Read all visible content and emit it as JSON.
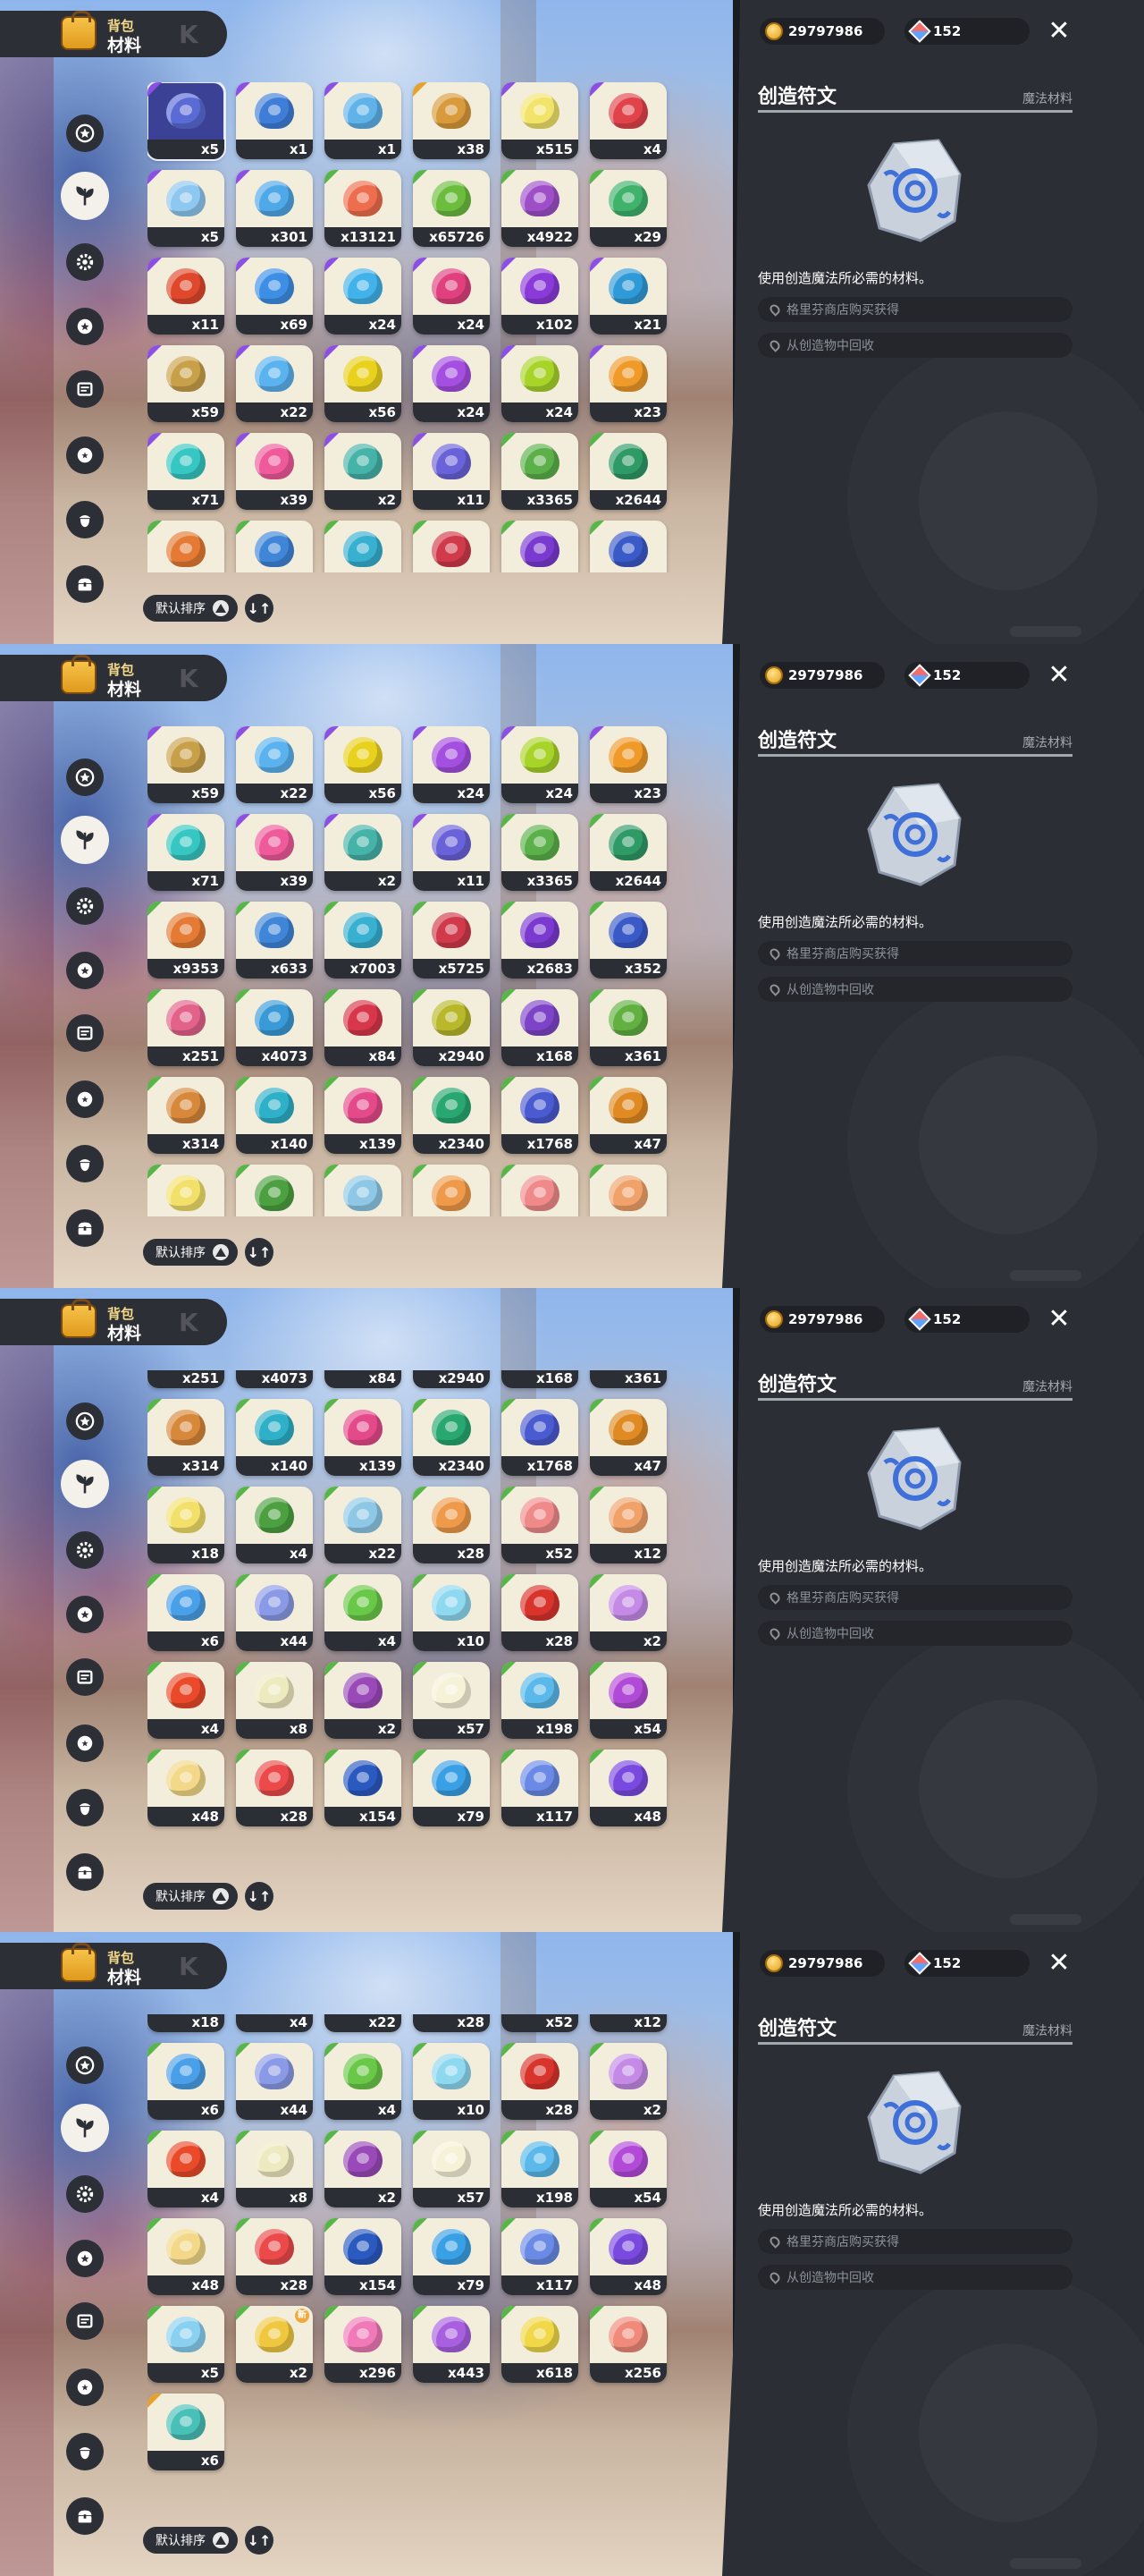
{
  "header": {
    "title_small": "背包",
    "title_big": "材料",
    "title_mark": "K"
  },
  "currency": {
    "gold": "29797986",
    "gems": "152"
  },
  "tabs": [
    "star-badge-icon",
    "leaf-icon",
    "gear-icon",
    "star-ring-icon",
    "potion-icon",
    "dragon-ball-icon",
    "acorn-icon",
    "chest-icon"
  ],
  "active_tab": 1,
  "sort": {
    "label": "默认排序",
    "order_icon": "↓↑"
  },
  "detail": {
    "name": "创造符文",
    "type": "魔法材料",
    "description": "使用创造魔法所必需的材料。",
    "sources": [
      "格里芬商店购买获得",
      "从创造物中回收"
    ]
  },
  "items": [
    {
      "id": "rune",
      "count": "x5",
      "color": "#5a6bd6",
      "rarity": "#8c4fe4"
    },
    {
      "id": "blue-pot",
      "count": "x1",
      "color": "#3f7ed8",
      "rarity": "#8c4fe4"
    },
    {
      "id": "necklace",
      "count": "x1",
      "color": "#5fb3e8",
      "rarity": "#8c4fe4"
    },
    {
      "id": "gold-orb",
      "count": "x38",
      "color": "#d89a3a",
      "rarity": "#e6a230"
    },
    {
      "id": "crystal",
      "count": "x515",
      "color": "#f2e36a",
      "rarity": "#8c4fe4"
    },
    {
      "id": "hat",
      "count": "x4",
      "color": "#e0444a",
      "rarity": "#8c4fe4"
    },
    {
      "id": "cloud",
      "count": "x5",
      "color": "#8ec7ef",
      "rarity": "#8c4fe4"
    },
    {
      "id": "ice",
      "count": "x301",
      "color": "#4fa8e8",
      "rarity": "#8c4fe4"
    },
    {
      "id": "peach",
      "count": "x13121",
      "color": "#ee6d4e",
      "rarity": "#58b548"
    },
    {
      "id": "green-fruit",
      "count": "x65726",
      "color": "#6cbd3e",
      "rarity": "#58b548"
    },
    {
      "id": "purple-fruit",
      "count": "x4922",
      "color": "#9e4fc8",
      "rarity": "#58b548"
    },
    {
      "id": "green-gem",
      "count": "x29",
      "color": "#3fb36c",
      "rarity": "#58b548"
    },
    {
      "id": "red-gem",
      "count": "x11",
      "color": "#e0482c",
      "rarity": "#8c4fe4"
    },
    {
      "id": "blue-gem",
      "count": "x69",
      "color": "#3d8fe6",
      "rarity": "#8c4fe4"
    },
    {
      "id": "sky-gem",
      "count": "x24",
      "color": "#42b2ea",
      "rarity": "#8c4fe4"
    },
    {
      "id": "pink-gem",
      "count": "x24",
      "color": "#e0407e",
      "rarity": "#8c4fe4"
    },
    {
      "id": "violet-gem",
      "count": "x102",
      "color": "#8a3ad8",
      "rarity": "#8c4fe4"
    },
    {
      "id": "azure-gem",
      "count": "x21",
      "color": "#2f9ad8",
      "rarity": "#8c4fe4"
    },
    {
      "id": "amber-gem",
      "count": "x59",
      "color": "#c9a04a",
      "rarity": "#8c4fe4"
    },
    {
      "id": "light-blue-gem",
      "count": "x22",
      "color": "#5ab2ee",
      "rarity": "#8c4fe4"
    },
    {
      "id": "yellow-gem",
      "count": "x56",
      "color": "#e9d21e",
      "rarity": "#8c4fe4"
    },
    {
      "id": "purple-gem",
      "count": "x24",
      "color": "#a44fe0",
      "rarity": "#8c4fe4"
    },
    {
      "id": "lime-gem",
      "count": "x24",
      "color": "#a8d42a",
      "rarity": "#8c4fe4"
    },
    {
      "id": "orange-gem",
      "count": "x23",
      "color": "#f09a2a",
      "rarity": "#8c4fe4"
    },
    {
      "id": "teal-gem",
      "count": "x71",
      "color": "#36c7c2",
      "rarity": "#8c4fe4"
    },
    {
      "id": "rose-gem",
      "count": "x39",
      "color": "#ee5a9a",
      "rarity": "#8c4fe4"
    },
    {
      "id": "mint-gem",
      "count": "x2",
      "color": "#45b3a8",
      "rarity": "#8c4fe4"
    },
    {
      "id": "swirl-gem",
      "count": "x11",
      "color": "#6a62d8",
      "rarity": "#8c4fe4"
    },
    {
      "id": "green-potion",
      "count": "x3365",
      "color": "#5cb04a",
      "rarity": "#58b548"
    },
    {
      "id": "jade-potion",
      "count": "x2644",
      "color": "#2e9a66",
      "rarity": "#58b548"
    },
    {
      "id": "orange-flask",
      "count": "x9353",
      "color": "#e47a34",
      "rarity": "#58b548"
    },
    {
      "id": "blue-flask",
      "count": "x633",
      "color": "#3f86d8",
      "rarity": "#58b548"
    },
    {
      "id": "cyan-flask",
      "count": "x7003",
      "color": "#38b0d0",
      "rarity": "#58b548"
    },
    {
      "id": "red-flask",
      "count": "x5725",
      "color": "#d03a4a",
      "rarity": "#58b548"
    },
    {
      "id": "violet-flask",
      "count": "x2683",
      "color": "#7a3ad0",
      "rarity": "#58b548"
    },
    {
      "id": "navy-flask",
      "count": "x352",
      "color": "#3a5ac8",
      "rarity": "#58b548"
    },
    {
      "id": "pink-flask",
      "count": "x251",
      "color": "#e2628a",
      "rarity": "#58b548"
    },
    {
      "id": "sea-flask",
      "count": "x4073",
      "color": "#3a9ad8",
      "rarity": "#58b548"
    },
    {
      "id": "ruby-flask",
      "count": "x84",
      "color": "#d8364a",
      "rarity": "#58b548"
    },
    {
      "id": "olive-flask",
      "count": "x2940",
      "color": "#b8b82a",
      "rarity": "#58b548"
    },
    {
      "id": "plum-flask",
      "count": "x168",
      "color": "#7e44c8",
      "rarity": "#58b548"
    },
    {
      "id": "grass-flask",
      "count": "x361",
      "color": "#62b040",
      "rarity": "#58b548"
    },
    {
      "id": "amber-flask",
      "count": "x314",
      "color": "#d8883a",
      "rarity": "#58b548"
    },
    {
      "id": "aqua-flask",
      "count": "x140",
      "color": "#2eb0c8",
      "rarity": "#58b548"
    },
    {
      "id": "magenta-flask",
      "count": "x139",
      "color": "#e44a8a",
      "rarity": "#58b548"
    },
    {
      "id": "emerald-flask",
      "count": "x2340",
      "color": "#28a870",
      "rarity": "#58b548"
    },
    {
      "id": "indigo-flask",
      "count": "x1768",
      "color": "#4a5ad0",
      "rarity": "#58b548"
    },
    {
      "id": "pumpkin",
      "count": "x47",
      "color": "#e08a24",
      "rarity": "#58b548"
    },
    {
      "id": "yellow-flower",
      "count": "x18",
      "color": "#f2e06a",
      "rarity": "#58b548"
    },
    {
      "id": "green-bud",
      "count": "x4",
      "color": "#4ca040",
      "rarity": "#58b548"
    },
    {
      "id": "blue-bell",
      "count": "x22",
      "color": "#8ec8e6",
      "rarity": "#58b548"
    },
    {
      "id": "orange-mushroom",
      "count": "x28",
      "color": "#ee9a4a",
      "rarity": "#58b548"
    },
    {
      "id": "pink-flower",
      "count": "x52",
      "color": "#f08a8a",
      "rarity": "#58b548"
    },
    {
      "id": "peach-flower",
      "count": "x12",
      "color": "#f0a26a",
      "rarity": "#58b548"
    },
    {
      "id": "blue-flower",
      "count": "x6",
      "color": "#4aa0e8",
      "rarity": "#58b548"
    },
    {
      "id": "iris",
      "count": "x44",
      "color": "#8a9ae6",
      "rarity": "#58b548"
    },
    {
      "id": "star-leaf",
      "count": "x4",
      "color": "#6ac848",
      "rarity": "#58b548"
    },
    {
      "id": "frost-flower",
      "count": "x10",
      "color": "#8ed8f0",
      "rarity": "#58b548"
    },
    {
      "id": "rose",
      "count": "x28",
      "color": "#d8342c",
      "rarity": "#58b548"
    },
    {
      "id": "lilac",
      "count": "x2",
      "color": "#c48ae6",
      "rarity": "#58b548"
    },
    {
      "id": "fire-lily",
      "count": "x4",
      "color": "#ea4a2a",
      "rarity": "#58b548"
    },
    {
      "id": "white-bud",
      "count": "x8",
      "color": "#eeeac0",
      "rarity": "#58b548"
    },
    {
      "id": "star-flower",
      "count": "x2",
      "color": "#9a4ab8",
      "rarity": "#58b548"
    },
    {
      "id": "daisy",
      "count": "x57",
      "color": "#f6f2d8",
      "rarity": "#58b548"
    },
    {
      "id": "ice-shard",
      "count": "x198",
      "color": "#5ab8ea",
      "rarity": "#58b548"
    },
    {
      "id": "violet-crest",
      "count": "x54",
      "color": "#b24ad8",
      "rarity": "#58b548"
    },
    {
      "id": "shell",
      "count": "x48",
      "color": "#f2d888",
      "rarity": "#58b548"
    },
    {
      "id": "red-lily",
      "count": "x28",
      "color": "#ec4a4a",
      "rarity": "#58b548"
    },
    {
      "id": "blue-coral",
      "count": "x154",
      "color": "#2a5ac0",
      "rarity": "#58b548"
    },
    {
      "id": "aqua-coral",
      "count": "x79",
      "color": "#3aa0e6",
      "rarity": "#58b548"
    },
    {
      "id": "blue-bottle",
      "count": "x117",
      "color": "#6a8ae6",
      "rarity": "#58b548"
    },
    {
      "id": "purple-bottle",
      "count": "x48",
      "color": "#7a4ae0",
      "rarity": "#58b548"
    },
    {
      "id": "ice-bottle",
      "count": "x5",
      "color": "#8ad0f0",
      "rarity": "#58b548"
    },
    {
      "id": "gold-bottle",
      "count": "x2",
      "color": "#f0c840",
      "rarity": "#58b548",
      "badge": "新"
    },
    {
      "id": "pink-bottle",
      "count": "x296",
      "color": "#f07ab8",
      "rarity": "#58b548"
    },
    {
      "id": "violet-bottle",
      "count": "x443",
      "color": "#a860e0",
      "rarity": "#58b548"
    },
    {
      "id": "yellow-bottle",
      "count": "x618",
      "color": "#f0d848",
      "rarity": "#58b548"
    },
    {
      "id": "coral-bottle",
      "count": "x256",
      "color": "#f08a7a",
      "rarity": "#58b548"
    },
    {
      "id": "teal-bottle",
      "count": "x6",
      "color": "#48c0b8",
      "rarity": "#e6a230"
    }
  ],
  "frames": [
    {
      "start": 0,
      "offset": 0
    },
    {
      "start": 18,
      "offset": 0
    },
    {
      "start": 36,
      "offset": 66
    },
    {
      "start": 48,
      "offset": 66
    }
  ]
}
